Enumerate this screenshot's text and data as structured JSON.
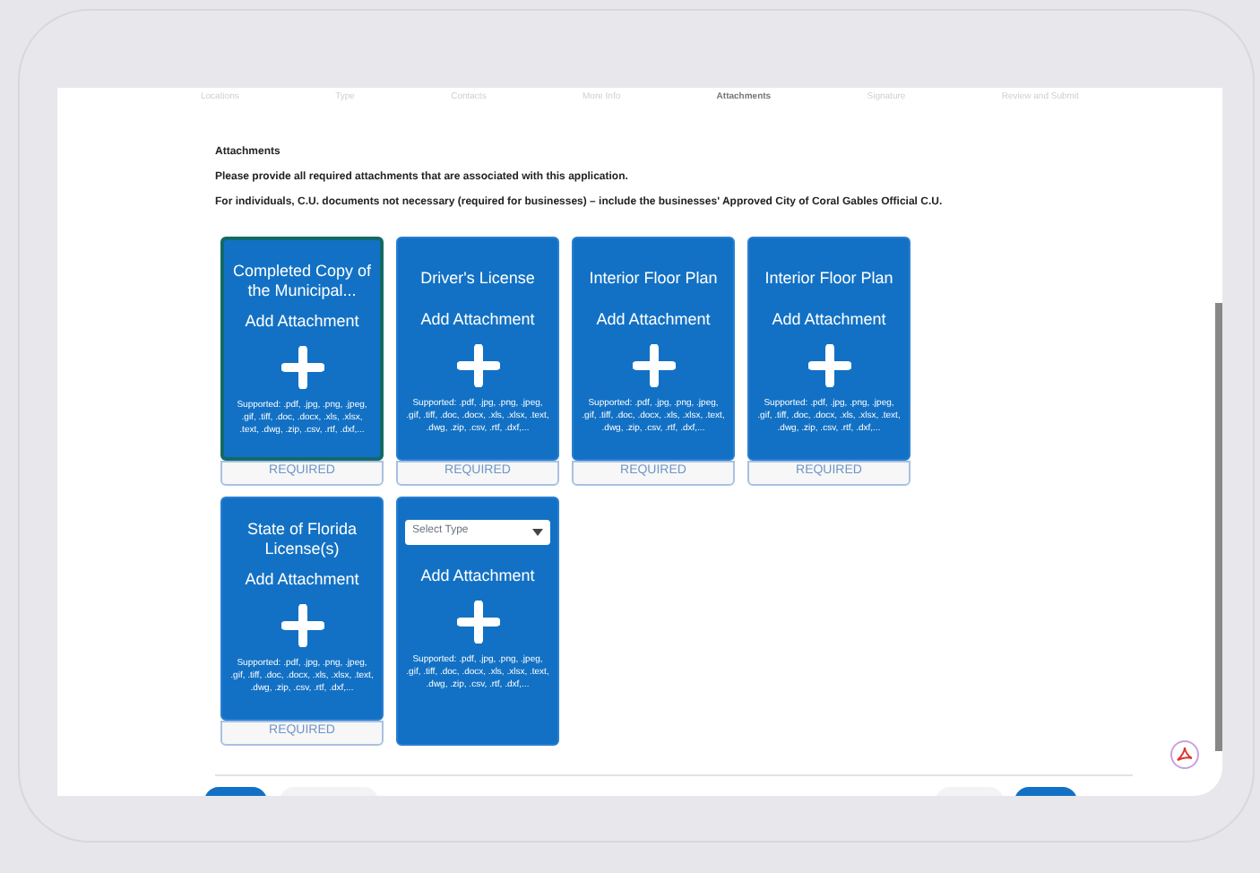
{
  "steps": [
    {
      "label": "Locations",
      "selected": false
    },
    {
      "label": "Type",
      "selected": false
    },
    {
      "label": "Contacts",
      "selected": false
    },
    {
      "label": "More Info",
      "selected": false
    },
    {
      "label": "Attachments",
      "selected": true
    },
    {
      "label": "Signature",
      "selected": false
    },
    {
      "label": "Review and Submit",
      "selected": false
    }
  ],
  "section": {
    "title": "Attachments",
    "lines": [
      "Please provide all required attachments that are associated with this application.",
      "For individuals, C.U. documents not necessary (required for businesses) – include the businesses' Approved City of Coral Gables Official C.U."
    ]
  },
  "cards": [
    {
      "kind": "titled",
      "title": "Completed Copy of the Municipal...",
      "action": "Add Attachment",
      "supported": "Supported: .pdf, .jpg, .png, .jpeg, .gif, .tiff, .doc, .docx, .xls, .xlsx, .text, .dwg, .zip, .csv, .rtf, .dxf,...",
      "required": "REQUIRED",
      "selected": true
    },
    {
      "kind": "titled",
      "title": "Driver's License",
      "action": "Add Attachment",
      "supported": "Supported: .pdf, .jpg, .png, .jpeg, .gif, .tiff, .doc, .docx, .xls, .xlsx, .text, .dwg, .zip, .csv, .rtf, .dxf,...",
      "required": "REQUIRED",
      "selected": false
    },
    {
      "kind": "titled",
      "title": "Interior Floor Plan",
      "action": "Add Attachment",
      "supported": "Supported: .pdf, .jpg, .png, .jpeg, .gif, .tiff, .doc, .docx, .xls, .xlsx, .text, .dwg, .zip, .csv, .rtf, .dxf,...",
      "required": "REQUIRED",
      "selected": false
    },
    {
      "kind": "titled",
      "title": "Interior Floor Plan",
      "action": "Add Attachment",
      "supported": "Supported: .pdf, .jpg, .png, .jpeg, .gif, .tiff, .doc, .docx, .xls, .xlsx, .text, .dwg, .zip, .csv, .rtf, .dxf,...",
      "required": "REQUIRED",
      "selected": false
    },
    {
      "kind": "titled",
      "title": "State of Florida License(s)",
      "action": "Add Attachment",
      "supported": "Supported: .pdf, .jpg, .png, .jpeg, .gif, .tiff, .doc, .docx, .xls, .xlsx, .text, .dwg, .zip, .csv, .rtf, .dxf,...",
      "required": "REQUIRED",
      "selected": false
    },
    {
      "kind": "select",
      "placeholder": "Select Type",
      "action": "Add Attachment",
      "supported": "Supported: .pdf, .jpg, .png, .jpeg, .gif, .tiff, .doc, .docx, .xls, .xlsx, .text, .dwg, .zip, .csv, .rtf, .dxf,...",
      "selected": false
    }
  ]
}
